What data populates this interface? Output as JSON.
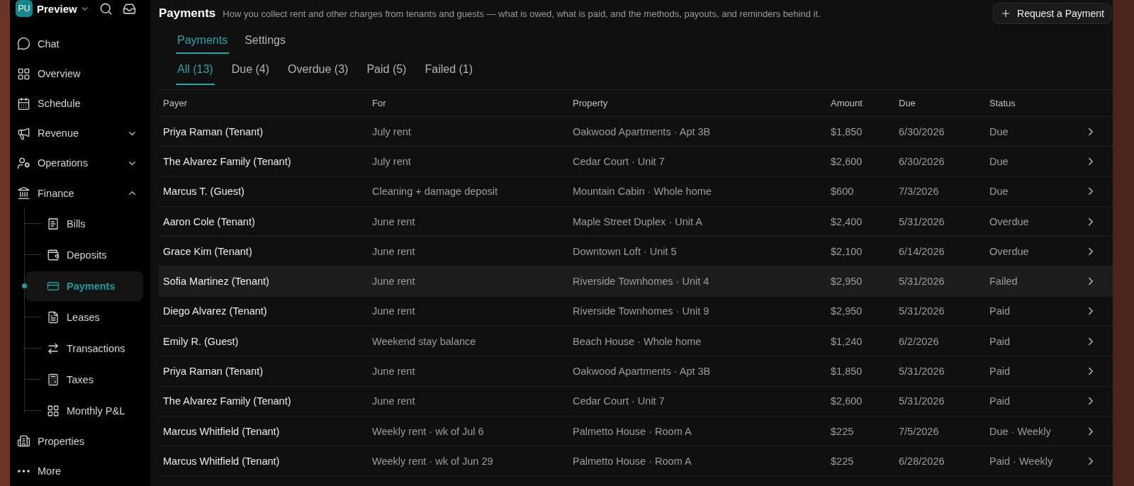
{
  "workspace": {
    "badge": "PU",
    "name": "Preview"
  },
  "sidebar": {
    "items": [
      {
        "label": "Chat",
        "kind": "item"
      },
      {
        "label": "Overview",
        "kind": "item"
      },
      {
        "label": "Schedule",
        "kind": "item"
      },
      {
        "label": "Revenue",
        "kind": "group",
        "expanded": false
      },
      {
        "label": "Operations",
        "kind": "group",
        "expanded": false
      },
      {
        "label": "Finance",
        "kind": "group",
        "expanded": true,
        "children": [
          {
            "label": "Bills",
            "selected": false
          },
          {
            "label": "Deposits",
            "selected": false
          },
          {
            "label": "Payments",
            "selected": true
          },
          {
            "label": "Leases",
            "selected": false
          },
          {
            "label": "Transactions",
            "selected": false
          },
          {
            "label": "Taxes",
            "selected": false
          },
          {
            "label": "Monthly P&L",
            "selected": false
          }
        ]
      },
      {
        "label": "Properties",
        "kind": "item"
      },
      {
        "label": "More",
        "kind": "item"
      }
    ]
  },
  "header": {
    "title": "Payments",
    "description": "How you collect rent and other charges from tenants and guests — what is owed, what is paid, and the methods, payouts, and reminders behind it.",
    "action": "Request a Payment"
  },
  "tabs": [
    {
      "label": "Payments",
      "selected": true
    },
    {
      "label": "Settings",
      "selected": false
    }
  ],
  "filters": [
    {
      "label": "All (13)",
      "selected": true
    },
    {
      "label": "Due (4)",
      "selected": false
    },
    {
      "label": "Overdue (3)",
      "selected": false
    },
    {
      "label": "Paid (5)",
      "selected": false
    },
    {
      "label": "Failed (1)",
      "selected": false
    }
  ],
  "table": {
    "columns": [
      "Payer",
      "For",
      "Property",
      "Amount",
      "Due",
      "Status"
    ],
    "rows": [
      {
        "payer": "Priya Raman (Tenant)",
        "for": "July rent",
        "property": "Oakwood Apartments · Apt 3B",
        "amount": "$1,850",
        "due": "6/30/2026",
        "status": "Due",
        "selected": false
      },
      {
        "payer": "The Alvarez Family (Tenant)",
        "for": "July rent",
        "property": "Cedar Court · Unit 7",
        "amount": "$2,600",
        "due": "6/30/2026",
        "status": "Due",
        "selected": false
      },
      {
        "payer": "Marcus T. (Guest)",
        "for": "Cleaning + damage deposit",
        "property": "Mountain Cabin · Whole home",
        "amount": "$600",
        "due": "7/3/2026",
        "status": "Due",
        "selected": false
      },
      {
        "payer": "Aaron Cole (Tenant)",
        "for": "June rent",
        "property": "Maple Street Duplex · Unit A",
        "amount": "$2,400",
        "due": "5/31/2026",
        "status": "Overdue",
        "selected": false
      },
      {
        "payer": "Grace Kim (Tenant)",
        "for": "June rent",
        "property": "Downtown Loft · Unit 5",
        "amount": "$2,100",
        "due": "6/14/2026",
        "status": "Overdue",
        "selected": false
      },
      {
        "payer": "Sofia Martinez (Tenant)",
        "for": "June rent",
        "property": "Riverside Townhomes · Unit 4",
        "amount": "$2,950",
        "due": "5/31/2026",
        "status": "Failed",
        "selected": true
      },
      {
        "payer": "Diego Alvarez (Tenant)",
        "for": "June rent",
        "property": "Riverside Townhomes · Unit 9",
        "amount": "$2,950",
        "due": "5/31/2026",
        "status": "Paid",
        "selected": false
      },
      {
        "payer": "Emily R. (Guest)",
        "for": "Weekend stay balance",
        "property": "Beach House · Whole home",
        "amount": "$1,240",
        "due": "6/2/2026",
        "status": "Paid",
        "selected": false
      },
      {
        "payer": "Priya Raman (Tenant)",
        "for": "June rent",
        "property": "Oakwood Apartments · Apt 3B",
        "amount": "$1,850",
        "due": "5/31/2026",
        "status": "Paid",
        "selected": false
      },
      {
        "payer": "The Alvarez Family (Tenant)",
        "for": "June rent",
        "property": "Cedar Court · Unit 7",
        "amount": "$2,600",
        "due": "5/31/2026",
        "status": "Paid",
        "selected": false
      },
      {
        "payer": "Marcus Whitfield (Tenant)",
        "for": "Weekly rent · wk of Jul 6",
        "property": "Palmetto House · Room A",
        "amount": "$225",
        "due": "7/5/2026",
        "status": "Due · Weekly",
        "selected": false
      },
      {
        "payer": "Marcus Whitfield (Tenant)",
        "for": "Weekly rent · wk of Jun 29",
        "property": "Palmetto House · Room A",
        "amount": "$225",
        "due": "6/28/2026",
        "status": "Paid · Weekly",
        "selected": false
      }
    ]
  }
}
